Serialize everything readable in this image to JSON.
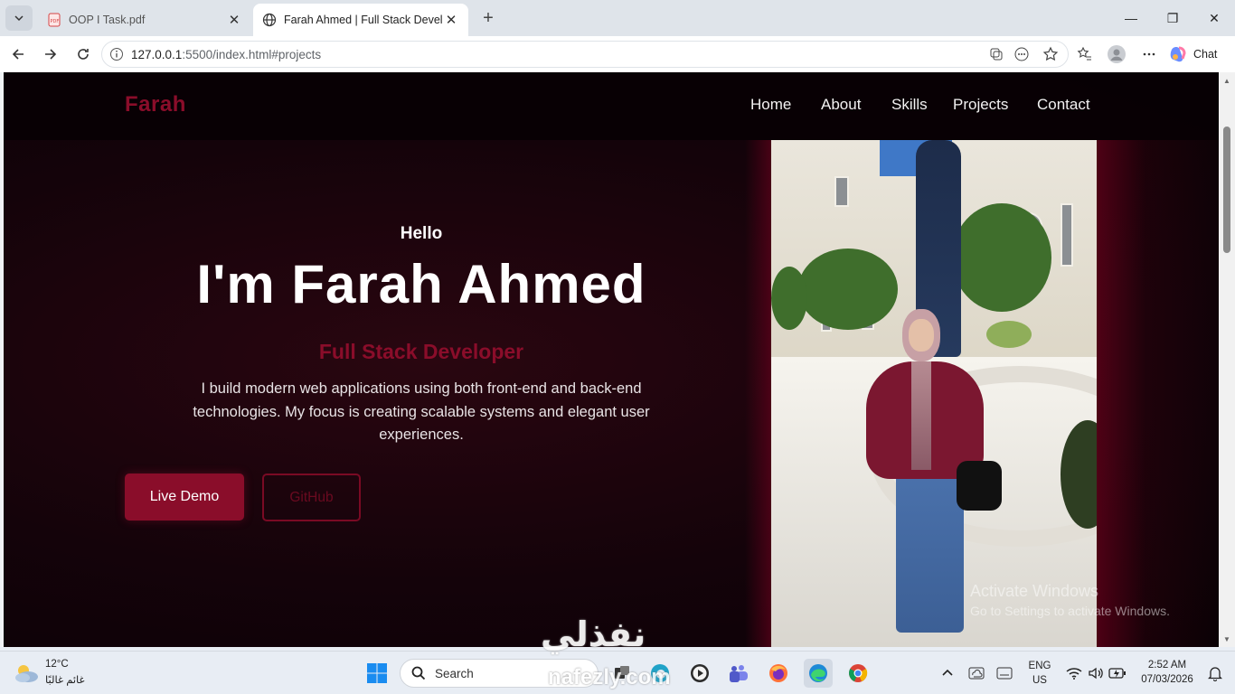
{
  "browser": {
    "tabs": [
      {
        "title": "OOP I Task.pdf",
        "active": false
      },
      {
        "title": "Farah Ahmed | Full Stack Develope",
        "active": true
      }
    ],
    "url_host": "127.0.0.1",
    "url_rest": ":5500/index.html#projects",
    "chat_label": "Chat"
  },
  "site": {
    "logo": "Farah",
    "nav": [
      "Home",
      "About",
      "Skills",
      "Projects",
      "Contact"
    ],
    "hello": "Hello",
    "headline": "I'm Farah Ahmed",
    "role": "Full Stack Developer",
    "description": "I build modern web applications using both front-end and back-end technologies. My focus is creating scalable systems and elegant user experiences.",
    "btn_demo": "Live Demo",
    "btn_github": "GitHub"
  },
  "watermark": {
    "line1": "Activate Windows",
    "line2": "Go to Settings to activate Windows."
  },
  "overlay": {
    "logo_text": "نفذلي",
    "url": "nafezly.com"
  },
  "taskbar": {
    "weather_temp": "12°C",
    "weather_desc": "غائم غالبًا",
    "search_placeholder": "Search",
    "lang_top": "ENG",
    "lang_bottom": "US",
    "time": "2:52 AM",
    "date": "07/03/2026"
  },
  "colors": {
    "accent": "#8a0d2a",
    "page_bg": "#14030a"
  }
}
